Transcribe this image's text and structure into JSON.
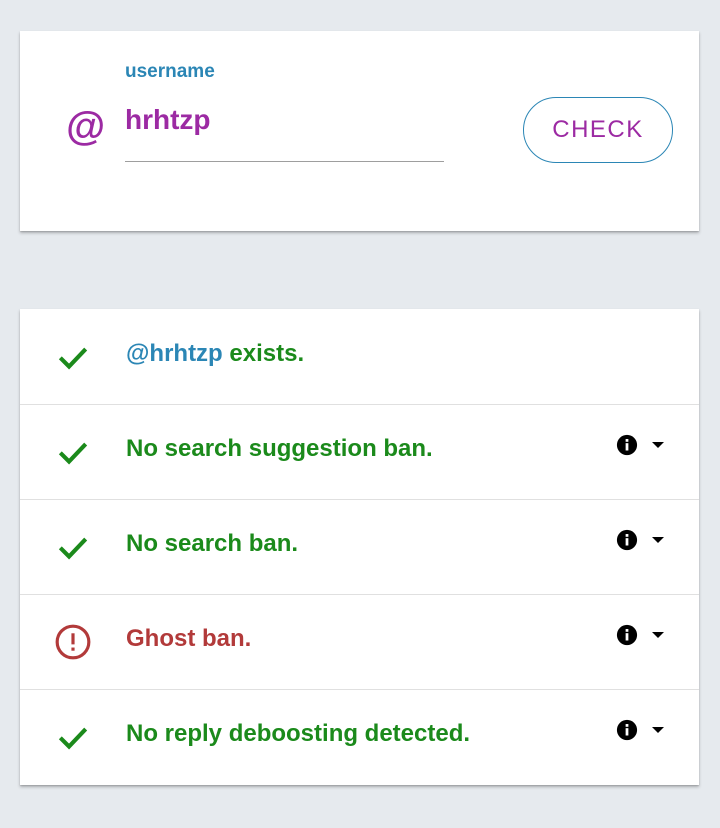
{
  "search": {
    "at_symbol": "@",
    "label": "username",
    "value": "hrhtzp",
    "button_label": "CHECK"
  },
  "results": [
    {
      "status": "ok",
      "icon": "check-icon",
      "handle": "@hrhtzp",
      "text": " exists.",
      "has_details": false
    },
    {
      "status": "ok",
      "icon": "check-icon",
      "text": "No search suggestion ban.",
      "has_details": true
    },
    {
      "status": "ok",
      "icon": "check-icon",
      "text": "No search ban.",
      "has_details": true
    },
    {
      "status": "bad",
      "icon": "alert-circle-icon",
      "text": "Ghost ban.",
      "has_details": true
    },
    {
      "status": "ok",
      "icon": "check-icon",
      "text": "No reply deboosting detected.",
      "has_details": true
    }
  ],
  "colors": {
    "accent": "#9c2aa3",
    "link": "#2b86b5",
    "ok": "#1b8a1b",
    "bad": "#b23a3a",
    "background": "#e6eaee"
  }
}
